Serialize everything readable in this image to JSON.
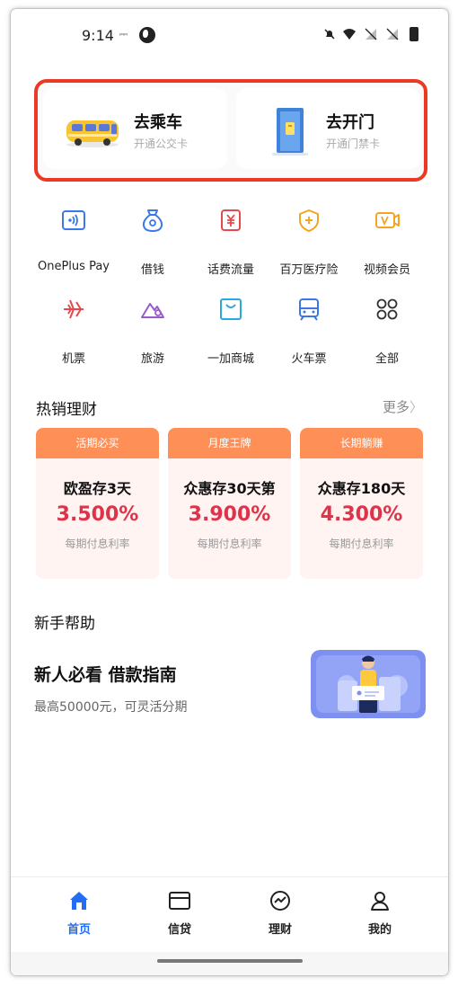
{
  "status_bar": {
    "time": "9:14",
    "tiny_text": "ᴵᴹᴹ",
    "icons": [
      "globe-icon",
      "bell-off-icon",
      "wifi-icon",
      "sim-off-icon",
      "sim-off-icon",
      "battery-icon"
    ]
  },
  "top_cards": {
    "highlight_color": "#ea3a23",
    "bus": {
      "title": "去乘车",
      "subtitle": "开通公交卡",
      "icon": "bus-icon"
    },
    "door": {
      "title": "去开门",
      "subtitle": "开通门禁卡",
      "icon": "door-card-icon"
    }
  },
  "grid": {
    "items": [
      {
        "label": "OnePlus Pay",
        "icon": "nfc-pay-icon"
      },
      {
        "label": "借钱",
        "icon": "money-bag-icon"
      },
      {
        "label": "话费流量",
        "icon": "yuan-bill-icon"
      },
      {
        "label": "百万医疗险",
        "icon": "shield-plus-icon"
      },
      {
        "label": "视频会员",
        "icon": "video-vip-icon"
      },
      {
        "label": "机票",
        "icon": "airplane-icon"
      },
      {
        "label": "旅游",
        "icon": "mountain-icon"
      },
      {
        "label": "一加商城",
        "icon": "shopping-bag-icon"
      },
      {
        "label": "火车票",
        "icon": "train-icon"
      },
      {
        "label": "全部",
        "icon": "grid-all-icon"
      }
    ]
  },
  "hot_finance": {
    "title": "热销理财",
    "more": "更多",
    "products": [
      {
        "tag": "活期必买",
        "name": "欧盈存3天",
        "rate": "3.500%",
        "rate_label": "每期付息利率"
      },
      {
        "tag": "月度王牌",
        "name": "众惠存30天第",
        "rate": "3.900%",
        "rate_label": "每期付息利率"
      },
      {
        "tag": "长期躺赚",
        "name": "众惠存180天",
        "rate": "4.300%",
        "rate_label": "每期付息利率"
      }
    ]
  },
  "help": {
    "section_title": "新手帮助",
    "title": "新人必看 借款指南",
    "subtitle": "最高50000元，可灵活分期"
  },
  "bottom_nav": {
    "active_color": "#1f6ef5",
    "items": [
      {
        "label": "首页",
        "icon": "home-icon"
      },
      {
        "label": "信贷",
        "icon": "card-icon"
      },
      {
        "label": "理财",
        "icon": "chart-circle-icon"
      },
      {
        "label": "我的",
        "icon": "person-icon"
      }
    ]
  }
}
